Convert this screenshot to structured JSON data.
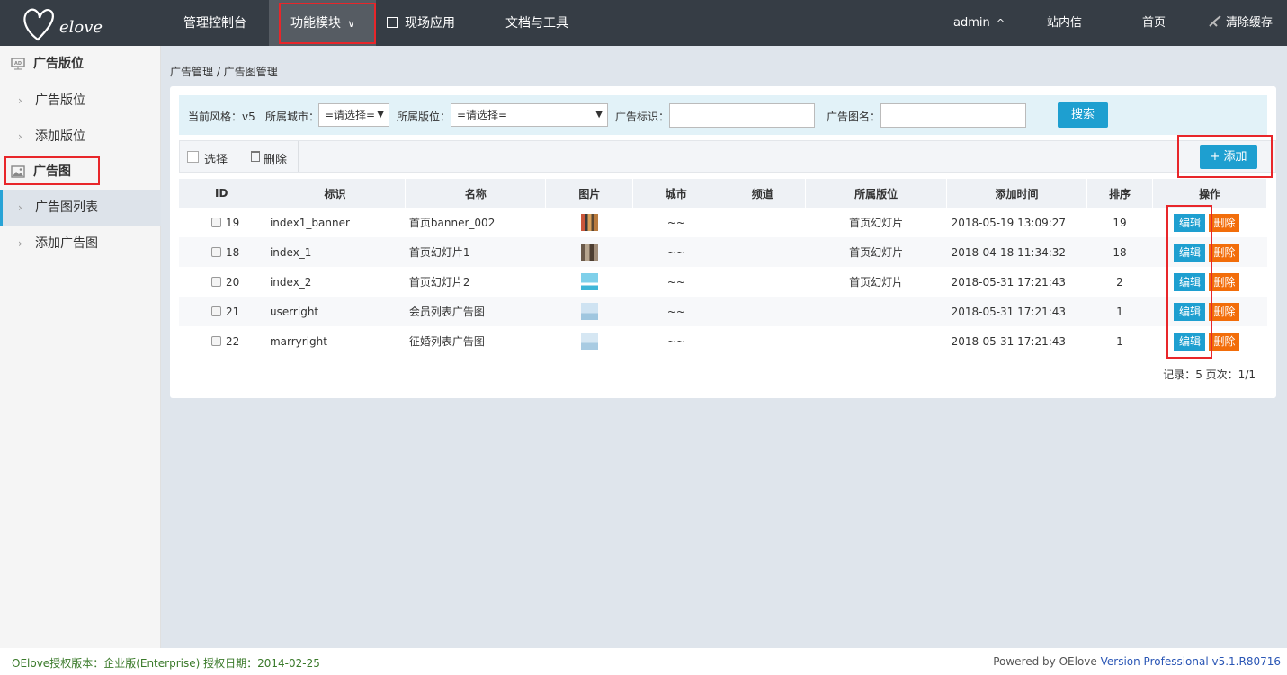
{
  "app": {
    "logo_text": "Oelove"
  },
  "topnav": {
    "items": [
      "管理控制台",
      "功能模块",
      "现场应用",
      "文档与工具"
    ],
    "dropdown_caret": "∨",
    "user": "admin",
    "user_caret": "^",
    "messages": "站内信",
    "home": "首页",
    "clear_cache": "清除缓存"
  },
  "sidebar": {
    "groups": [
      {
        "title": "广告版位",
        "icon": "ad-icon",
        "items": [
          "广告版位",
          "添加版位"
        ]
      },
      {
        "title": "广告图",
        "icon": "image-icon",
        "items": [
          "广告图列表",
          "添加广告图"
        ]
      }
    ],
    "active_item": "广告图列表"
  },
  "breadcrumb": "广告管理 / 广告图管理",
  "search": {
    "style_label": "当前风格：v5",
    "city_label": "所属城市：",
    "city_value": "=请选择=",
    "slot_label": "所属版位：",
    "slot_value": "=请选择=",
    "tag_label": "广告标识：",
    "tag_value": "",
    "name_label": "广告图名：",
    "name_value": "",
    "search_button": "搜索"
  },
  "toolbar": {
    "select_label": "选择",
    "delete_label": "删除",
    "add_label": "+ 添加"
  },
  "table": {
    "headers": [
      "ID",
      "标识",
      "名称",
      "图片",
      "城市",
      "频道",
      "所属版位",
      "添加时间",
      "排序",
      "操作"
    ],
    "rows": [
      {
        "id": "19",
        "tag": "index1_banner",
        "name": "首页banner_002",
        "city": "~~",
        "channel": "",
        "slot": "首页幻灯片",
        "time": "2018-05-19 13:09:27",
        "order": "19"
      },
      {
        "id": "18",
        "tag": "index_1",
        "name": "首页幻灯片1",
        "city": "~~",
        "channel": "",
        "slot": "首页幻灯片",
        "time": "2018-04-18 11:34:32",
        "order": "18"
      },
      {
        "id": "20",
        "tag": "index_2",
        "name": "首页幻灯片2",
        "city": "~~",
        "channel": "",
        "slot": "首页幻灯片",
        "time": "2018-05-31 17:21:43",
        "order": "2"
      },
      {
        "id": "21",
        "tag": "userright",
        "name": "会员列表广告图",
        "city": "~~",
        "channel": "",
        "slot": "",
        "time": "2018-05-31 17:21:43",
        "order": "1"
      },
      {
        "id": "22",
        "tag": "marryright",
        "name": "征婚列表广告图",
        "city": "~~",
        "channel": "",
        "slot": "",
        "time": "2018-05-31 17:21:43",
        "order": "1"
      }
    ],
    "edit_label": "编辑",
    "delete_label": "删除"
  },
  "pager": "记录：5  页次：1/1",
  "footer": {
    "license": "OElove授权版本：企业版(Enterprise) 授权日期：2014-02-25",
    "powered": "Powered by OElove",
    "version": "Version Professional v5.1.R80716"
  },
  "colors": {
    "topbar": "#363d45",
    "accent_blue": "#1e9fd0",
    "delete_orange": "#f26d0a",
    "highlight_red": "#e8262a"
  }
}
